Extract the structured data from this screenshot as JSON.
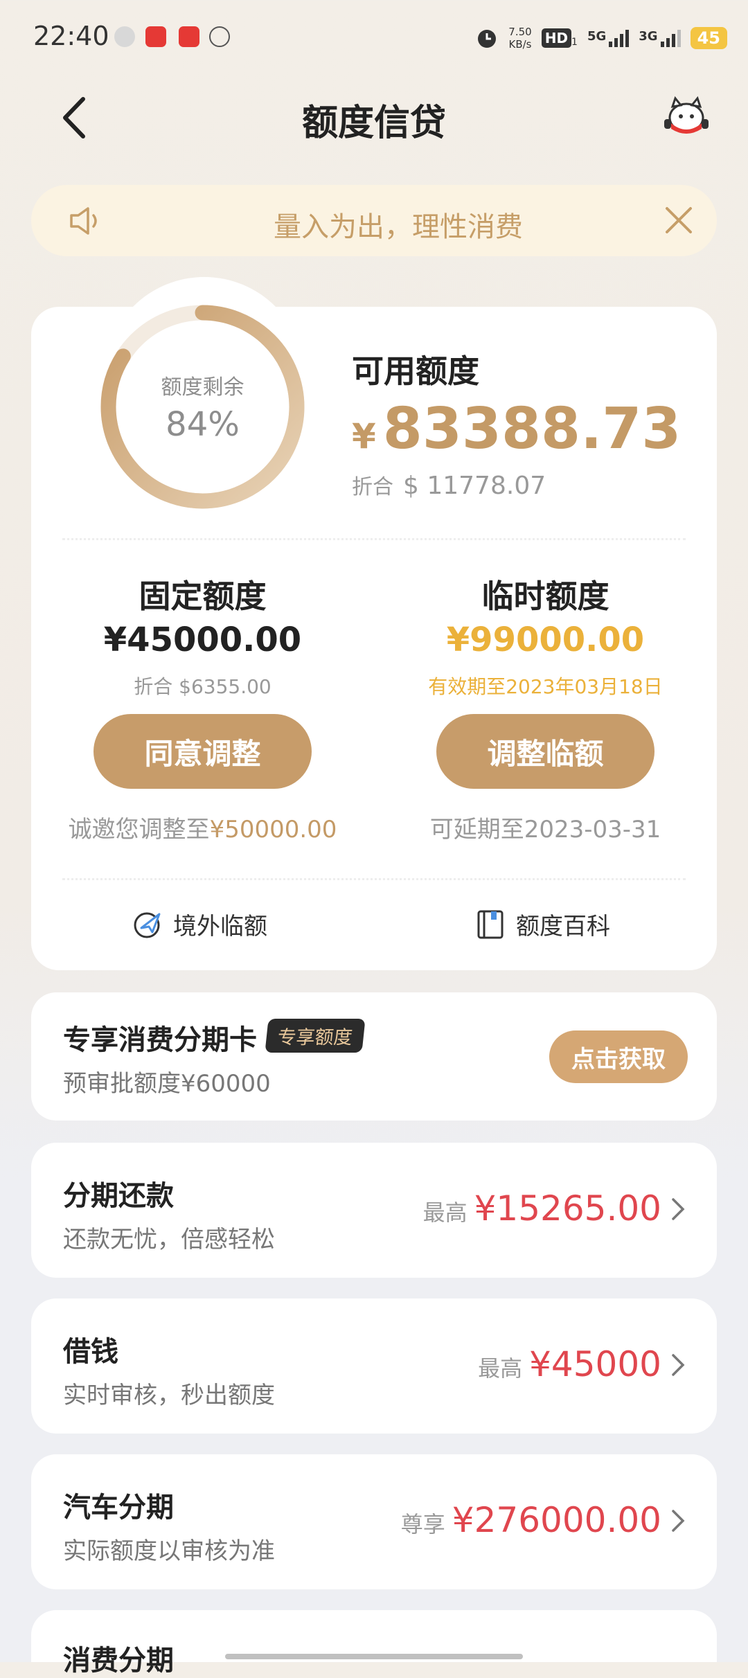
{
  "status_bar": {
    "time": "22:40",
    "speed_top": "7.50",
    "speed_unit": "KB/s",
    "hd_label": "HD",
    "hd_sub": "1",
    "net1": "5G",
    "net2": "3G",
    "battery": "45"
  },
  "header": {
    "title": "额度信贷"
  },
  "notice": {
    "text": "量入为出，理性消费"
  },
  "summary": {
    "ring_label": "额度剩余",
    "ring_percent_text": "84%",
    "ring_fraction": 0.84,
    "available_label": "可用额度",
    "available_currency": "¥",
    "available_amount": "83388.73",
    "converted_label": "折合",
    "converted_amount": "$ 11778.07"
  },
  "fixed": {
    "title": "固定额度",
    "amount": "¥45000.00",
    "converted": "折合 $6355.00",
    "button": "同意调整",
    "note_prefix": "诚邀您调整至",
    "note_amount": "¥50000.00"
  },
  "temporary": {
    "title": "临时额度",
    "amount": "¥99000.00",
    "validity": "有效期至2023年03月18日",
    "button": "调整临额",
    "note": "可延期至2023-03-31"
  },
  "links": {
    "overseas": "境外临额",
    "wiki": "额度百科"
  },
  "promo": {
    "title": "专享消费分期卡",
    "badge": "专享额度",
    "subtitle": "预审批额度¥60000",
    "button": "点击获取"
  },
  "list": [
    {
      "title": "分期还款",
      "subtitle": "还款无忧，倍感轻松",
      "prefix": "最高",
      "amount": "¥15265.00"
    },
    {
      "title": "借钱",
      "subtitle": "实时审核，秒出额度",
      "prefix": "最高",
      "amount": "¥45000"
    },
    {
      "title": "汽车分期",
      "subtitle": "实际额度以审核为准",
      "prefix": "尊享",
      "amount": "¥276000.00"
    },
    {
      "title": "消费分期"
    }
  ],
  "colors": {
    "gold": "#c49a66",
    "button": "#c79c6a",
    "temp_amount": "#ebb13a",
    "red_amount": "#e0464e",
    "notice_bg": "#fbf3e2"
  }
}
